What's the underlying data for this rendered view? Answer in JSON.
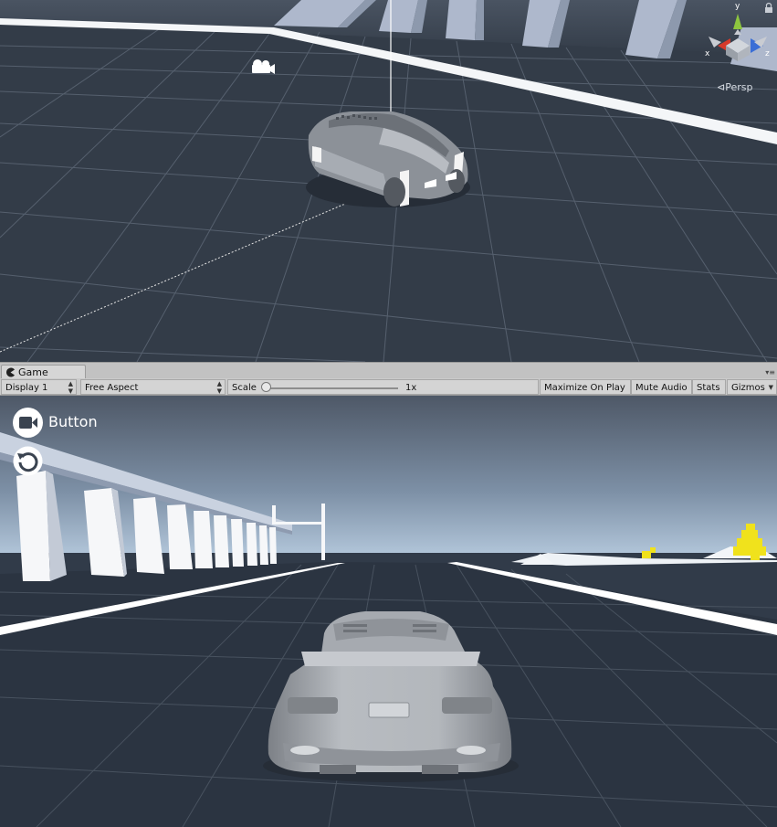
{
  "scene_view": {
    "persp_label": "Persp",
    "axis_labels": {
      "y": "y",
      "x": "x",
      "z": "z"
    },
    "icons": [
      "camera-gizmo-icon",
      "lock-icon",
      "orientation-gizmo-icon",
      "directional-light-line"
    ]
  },
  "game_window": {
    "tab_label": "Game",
    "tab_icon": "pacman-game-icon",
    "toolbar": {
      "display": "Display 1",
      "aspect": "Free Aspect",
      "scale_label": "Scale",
      "scale_value": "1x",
      "maximize": "Maximize On Play",
      "mute": "Mute Audio",
      "stats": "Stats",
      "gizmos": "Gizmos"
    }
  },
  "game_view": {
    "camera_button_label": "Button",
    "icons": [
      "video-camera-icon",
      "reset-rotate-icon"
    ]
  },
  "colors": {
    "scene_bg": "#333c48",
    "grid": "#5a6473",
    "sky_top": "#555f6e",
    "horizon": "#a9bed4",
    "road": "#2c3543",
    "car": "#9a9ea4",
    "gizmo_y": "#8ec63f",
    "gizmo_x": "#d63a2b",
    "gizmo_z": "#3a6ed6",
    "yellow_blocks": "#f0e21c"
  }
}
